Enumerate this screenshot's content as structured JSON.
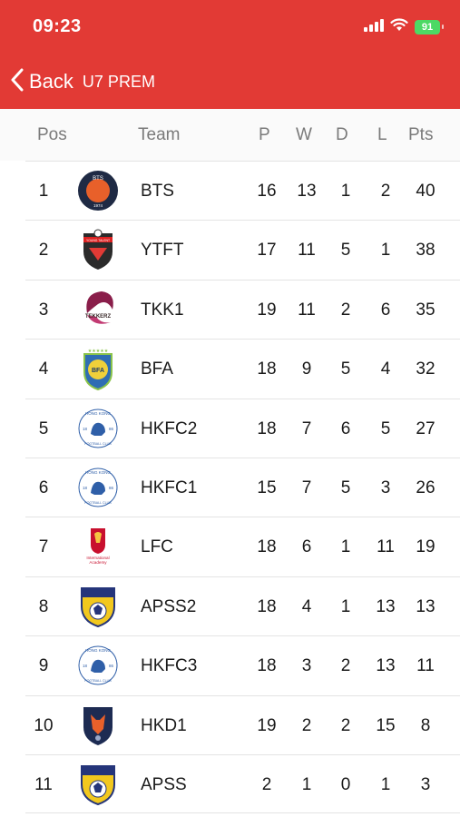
{
  "status": {
    "time": "09:23",
    "battery": "91"
  },
  "nav": {
    "back_label": "Back",
    "title": "U7 PREM"
  },
  "headers": {
    "pos": "Pos",
    "team": "Team",
    "p": "P",
    "w": "W",
    "d": "D",
    "l": "L",
    "pts": "Pts"
  },
  "rows": [
    {
      "pos": "1",
      "team": "BTS",
      "p": "16",
      "w": "13",
      "d": "1",
      "l": "2",
      "pts": "40",
      "logo": "bts-badge-icon",
      "logo_text": "BTS",
      "logo_year": "1974"
    },
    {
      "pos": "2",
      "team": "YTFT",
      "p": "17",
      "w": "11",
      "d": "5",
      "l": "1",
      "pts": "38",
      "logo": "young-talent-shield-icon",
      "logo_text": "YOUNG TALENT"
    },
    {
      "pos": "3",
      "team": "TKK1",
      "p": "19",
      "w": "11",
      "d": "2",
      "l": "6",
      "pts": "35",
      "logo": "tekkerz-ball-icon",
      "logo_text": "TEKKERZ"
    },
    {
      "pos": "4",
      "team": "BFA",
      "p": "18",
      "w": "9",
      "d": "5",
      "l": "4",
      "pts": "32",
      "logo": "bfa-shield-icon",
      "logo_text": "BFA"
    },
    {
      "pos": "5",
      "team": "HKFC2",
      "p": "18",
      "w": "7",
      "d": "6",
      "l": "5",
      "pts": "27",
      "logo": "hong-kong-football-club-icon",
      "logo_text": "HONG KONG",
      "logo_sub": "FOOTBALL CLUB",
      "logo_year_l": "18",
      "logo_year_r": "86"
    },
    {
      "pos": "6",
      "team": "HKFC1",
      "p": "15",
      "w": "7",
      "d": "5",
      "l": "3",
      "pts": "26",
      "logo": "hong-kong-football-club-icon",
      "logo_text": "HONG KONG",
      "logo_sub": "FOOTBALL CLUB",
      "logo_year_l": "18",
      "logo_year_r": "86"
    },
    {
      "pos": "7",
      "team": "LFC",
      "p": "18",
      "w": "6",
      "d": "1",
      "l": "11",
      "pts": "19",
      "logo": "liverpool-crest-icon",
      "logo_text": "International",
      "logo_sub": "Academy"
    },
    {
      "pos": "8",
      "team": "APSS2",
      "p": "18",
      "w": "4",
      "d": "1",
      "l": "13",
      "pts": "13",
      "logo": "apss-shield-icon"
    },
    {
      "pos": "9",
      "team": "HKFC3",
      "p": "18",
      "w": "3",
      "d": "2",
      "l": "13",
      "pts": "11",
      "logo": "hong-kong-football-club-icon",
      "logo_text": "HONG KONG",
      "logo_sub": "FOOTBALL CLUB",
      "logo_year_l": "18",
      "logo_year_r": "86"
    },
    {
      "pos": "10",
      "team": "HKD1",
      "p": "19",
      "w": "2",
      "d": "2",
      "l": "15",
      "pts": "8",
      "logo": "hkd-fox-shield-icon"
    },
    {
      "pos": "11",
      "team": "APSS",
      "p": "2",
      "w": "1",
      "d": "0",
      "l": "1",
      "pts": "3",
      "logo": "apss-shield-icon"
    }
  ],
  "colors": {
    "header_red": "#e23a35",
    "battery_green": "#4cd964",
    "row_divider": "#e4e4e4",
    "header_text": "#7a7a7a"
  }
}
